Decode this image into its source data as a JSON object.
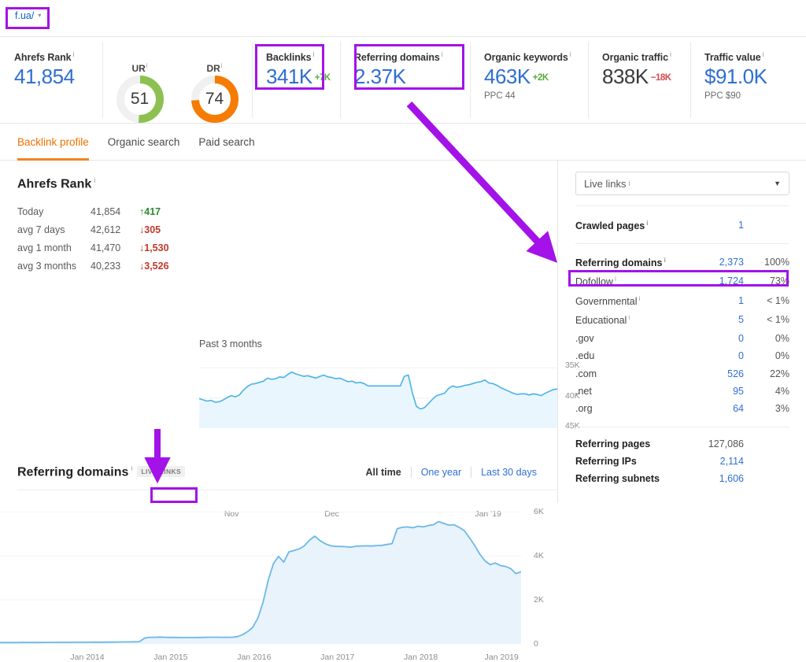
{
  "urlbar": {
    "site": "f.ua/",
    "caret": "▾"
  },
  "metrics": [
    {
      "id": "ahrefs-rank",
      "label": "Ahrefs Rank",
      "info": "i",
      "value": "41,854"
    },
    {
      "id": "backlinks",
      "label": "Backlinks",
      "info": "i",
      "value": "341K",
      "delta": "+7K",
      "delta_dir": "up"
    },
    {
      "id": "referring-domains",
      "label": "Referring domains",
      "info": "i",
      "value": "2.37K"
    },
    {
      "id": "organic-keywords",
      "label": "Organic keywords",
      "info": "i",
      "value": "463K",
      "delta": "+2K",
      "delta_dir": "up",
      "ppc": "PPC 44"
    },
    {
      "id": "organic-traffic",
      "label": "Organic traffic",
      "info": "i",
      "value": "838K",
      "delta": "−18K",
      "delta_dir": "down"
    },
    {
      "id": "traffic-value",
      "label": "Traffic value",
      "info": "i",
      "value": "$91.0K",
      "ppc": "PPC $90"
    }
  ],
  "gauges": [
    {
      "id": "ur",
      "label": "UR",
      "info": "i",
      "value": "51",
      "percent": 51,
      "color": "#8cc152"
    },
    {
      "id": "dr",
      "label": "DR",
      "info": "i",
      "value": "74",
      "percent": 74,
      "color": "#f57c00"
    }
  ],
  "tabs": [
    {
      "label": "Backlink profile",
      "active": true
    },
    {
      "label": "Organic search",
      "active": false
    },
    {
      "label": "Paid search",
      "active": false
    }
  ],
  "rank_panel": {
    "title": "Ahrefs Rank",
    "info": "i",
    "rows": [
      {
        "key": "Today",
        "value": "41,854",
        "delta": "417",
        "dir": "up",
        "arrow": "↑"
      },
      {
        "key": "avg 7 days",
        "value": "42,612",
        "delta": "305",
        "dir": "down",
        "arrow": "↓"
      },
      {
        "key": "avg 1 month",
        "value": "41,470",
        "delta": "1,530",
        "dir": "down",
        "arrow": "↓"
      },
      {
        "key": "avg 3 months",
        "value": "40,233",
        "delta": "3,526",
        "dir": "down",
        "arrow": "↓"
      }
    ]
  },
  "referring_domains_section": {
    "title": "Referring domains",
    "info": "i",
    "badge": "LIVE LINKS",
    "ranges": [
      {
        "label": "All time",
        "active": true
      },
      {
        "label": "One year",
        "active": false
      },
      {
        "label": "Last 30 days",
        "active": false
      }
    ]
  },
  "sidebar": {
    "select": {
      "label": "Live links",
      "info": "i",
      "caret": "▼"
    },
    "crawled": {
      "label": "Crawled pages",
      "info": "i",
      "value": "1"
    },
    "breakdown": [
      {
        "label": "Referring domains",
        "info": "i",
        "value": "2,373",
        "pct": "100%",
        "bold": true
      },
      {
        "label": "Dofollow",
        "info": "i",
        "value": "1,724",
        "pct": "73%",
        "bold": false,
        "highlighted": true
      },
      {
        "label": "Governmental",
        "info": "i",
        "value": "1",
        "pct": "< 1%",
        "bold": false
      },
      {
        "label": "Educational",
        "info": "i",
        "value": "5",
        "pct": "< 1%",
        "bold": false
      },
      {
        "label": ".gov",
        "info": "",
        "value": "0",
        "pct": "0%",
        "bold": false
      },
      {
        "label": ".edu",
        "info": "",
        "value": "0",
        "pct": "0%",
        "bold": false
      },
      {
        "label": ".com",
        "info": "",
        "value": "526",
        "pct": "22%",
        "bold": false
      },
      {
        "label": ".net",
        "info": "",
        "value": "95",
        "pct": "4%",
        "bold": false
      },
      {
        "label": ".org",
        "info": "",
        "value": "64",
        "pct": "3%",
        "bold": false
      }
    ],
    "totals": [
      {
        "label": "Referring pages",
        "value": "127,086",
        "gray": true
      },
      {
        "label": "Referring IPs",
        "value": "2,114",
        "gray": false
      },
      {
        "label": "Referring subnets",
        "value": "1,606",
        "gray": false
      }
    ]
  },
  "chart_data": [
    {
      "id": "ahrefs-rank-sparkline",
      "type": "line",
      "title": "Past 3 months",
      "xlabel": "",
      "ylabel": "",
      "inverted_y": true,
      "ylim": [
        45000,
        33000
      ],
      "yticks": [
        "35K",
        "40K",
        "45K"
      ],
      "xticks": [
        "Nov",
        "Dec",
        "Jan '19"
      ],
      "grid": true,
      "legend": "none",
      "line_color": "#4ab2e8",
      "fill_color": "#eaf6fd",
      "x": [
        0,
        1,
        2,
        3,
        4,
        5,
        6,
        7,
        8,
        9,
        10,
        11,
        12,
        13,
        14,
        15,
        16,
        17,
        18,
        19,
        20,
        21,
        22,
        23,
        24,
        25,
        26,
        27,
        28,
        29,
        30,
        31,
        32,
        33,
        34,
        35,
        36,
        37,
        38,
        39,
        40,
        41,
        42,
        43,
        44,
        45,
        46,
        47,
        48,
        49,
        50,
        51,
        52,
        53,
        54,
        55,
        56,
        57,
        58,
        59,
        60,
        61,
        62,
        63,
        64,
        65,
        66,
        67,
        68,
        69,
        70,
        71,
        72,
        73,
        74,
        75,
        76,
        77,
        78,
        79,
        80,
        81,
        82,
        83,
        84,
        85,
        86,
        87,
        88,
        89
      ],
      "values": [
        40100,
        40300,
        40500,
        40400,
        40700,
        40600,
        40300,
        39900,
        39600,
        39800,
        39500,
        38700,
        38100,
        37700,
        37600,
        37400,
        37200,
        36700,
        36900,
        36800,
        36500,
        36600,
        36100,
        35700,
        36000,
        36200,
        36400,
        36300,
        36500,
        36700,
        36400,
        36200,
        36500,
        36600,
        36800,
        36700,
        37000,
        37300,
        37200,
        37500,
        37400,
        37600,
        38000,
        38000,
        38000,
        38000,
        38000,
        38000,
        38000,
        38000,
        38000,
        36400,
        36200,
        39200,
        41400,
        41800,
        41600,
        40900,
        40200,
        39600,
        39400,
        39200,
        38400,
        38000,
        38200,
        38100,
        37900,
        37800,
        37600,
        37400,
        37300,
        37000,
        37500,
        37600,
        37900,
        38300,
        38600,
        38900,
        39200,
        39400,
        39300,
        39300,
        39500,
        39300,
        39400,
        39600,
        39200,
        38900,
        38600,
        38500
      ]
    },
    {
      "id": "referring-domains-chart",
      "type": "area",
      "title": "Referring domains",
      "xlabel": "",
      "ylabel": "",
      "ylim": [
        0,
        6800
      ],
      "yticks": [
        "6K",
        "4K",
        "2K",
        "0"
      ],
      "xticks": [
        "Jan 2014",
        "Jan 2015",
        "Jan 2016",
        "Jan 2017",
        "Jan 2018",
        "Jan 2019"
      ],
      "grid": true,
      "legend": "none",
      "line_color": "#6cb8e8",
      "fill_color": "#e8f3fc",
      "x": [
        0,
        1,
        2,
        3,
        4,
        5,
        6,
        7,
        8,
        9,
        10,
        11,
        12,
        13,
        14,
        15,
        16,
        17,
        18,
        19,
        20,
        21,
        22,
        23,
        24,
        25,
        26,
        27,
        28,
        29,
        30,
        31,
        32,
        33,
        34,
        35,
        36,
        37,
        38,
        39,
        40,
        41,
        42,
        43,
        44,
        45,
        46,
        47,
        48,
        49,
        50,
        51,
        52,
        53,
        54,
        55,
        56,
        57,
        58,
        59,
        60,
        61,
        62,
        63,
        64,
        65,
        66,
        67,
        68,
        69,
        70,
        71,
        72,
        73,
        74,
        75,
        76,
        77,
        78,
        79,
        80,
        81,
        82,
        83,
        84,
        85,
        86,
        87,
        88,
        89,
        90,
        91,
        92,
        93,
        94,
        95,
        96,
        97,
        98,
        99
      ],
      "values": [
        60,
        60,
        62,
        62,
        63,
        64,
        64,
        66,
        66,
        68,
        68,
        70,
        70,
        72,
        72,
        74,
        76,
        76,
        78,
        78,
        80,
        82,
        84,
        86,
        88,
        90,
        95,
        100,
        260,
        300,
        300,
        310,
        300,
        295,
        295,
        290,
        290,
        290,
        290,
        295,
        300,
        305,
        305,
        300,
        300,
        305,
        330,
        420,
        560,
        760,
        1180,
        1900,
        2900,
        3650,
        3980,
        3720,
        4180,
        4250,
        4320,
        4460,
        4720,
        4900,
        4700,
        4560,
        4470,
        4430,
        4430,
        4420,
        4400,
        4440,
        4450,
        4460,
        4450,
        4470,
        4480,
        4520,
        4560,
        5240,
        5300,
        5320,
        5280,
        5350,
        5320,
        5380,
        5420,
        5560,
        5480,
        5400,
        5420,
        5300,
        5150,
        4820,
        4480,
        4080,
        3780,
        3600,
        3680,
        3560,
        3520,
        3420,
        3200,
        3280
      ]
    }
  ],
  "annotations": {
    "color": "#a312e8",
    "boxes": [
      "url-chip",
      "backlinks-card",
      "referring-domains-card",
      "dofollow-row",
      "jan-2015-tick"
    ],
    "arrows": [
      "referring-domains-to-sidebar",
      "jan-2015-pointer"
    ]
  }
}
